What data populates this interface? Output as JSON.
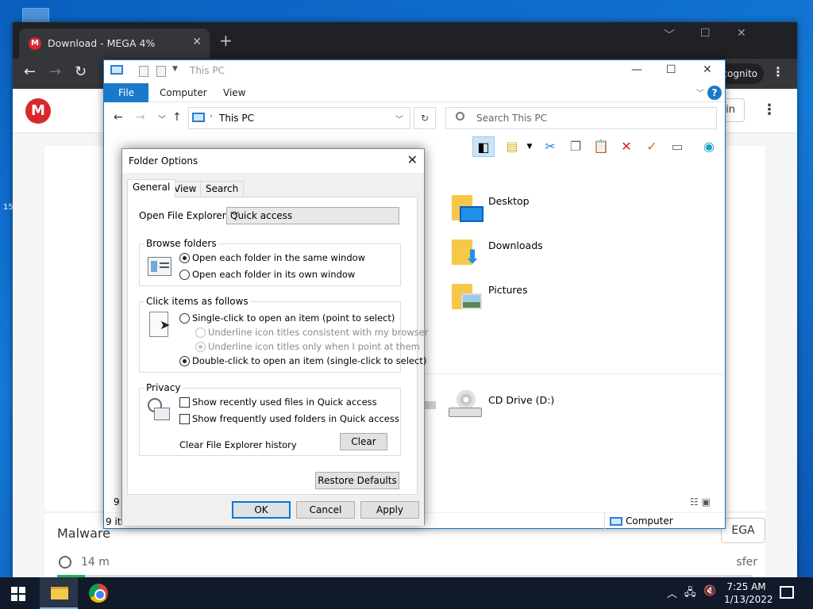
{
  "chrome": {
    "tab_title": "Download - MEGA 4%",
    "tab_close": "✕",
    "new_tab": "+",
    "incognito_label": "cognito",
    "back": "←",
    "forward": "→",
    "reload": "↻"
  },
  "mega": {
    "logo": "M",
    "sign_in_fragment": "in",
    "title_fragment": "Malware",
    "right_button_fragment": "EGA",
    "speed_fragment": "14 m",
    "transfer_fragment": "sfer",
    "progress_percent": 4,
    "brand_color": "#d9272e",
    "progress_color": "#20b45a"
  },
  "explorer": {
    "title": "This PC",
    "ribbon_tabs": [
      "File",
      "Computer",
      "View"
    ],
    "address": "This PC",
    "search_placeholder": "Search This PC",
    "folders": [
      "Desktop",
      "Downloads",
      "Pictures"
    ],
    "drive": "CD Drive (D:)",
    "status_items": "9 ite",
    "status_fragment": "9",
    "status_location": "Computer",
    "accent_color": "#1979ca"
  },
  "folder_options": {
    "title": "Folder Options",
    "tabs": [
      "General",
      "View",
      "Search"
    ],
    "open_to_label": "Open File Explorer to:",
    "open_to_value": "Quick access",
    "browse": {
      "title": "Browse folders",
      "same_window": "Open each folder in the same window",
      "own_window": "Open each folder in its own window"
    },
    "click": {
      "title": "Click items as follows",
      "single": "Single-click to open an item (point to select)",
      "underline_consistent": "Underline icon titles consistent with my browser",
      "underline_point": "Underline icon titles only when I point at them",
      "double": "Double-click to open an item (single-click to select)"
    },
    "privacy": {
      "title": "Privacy",
      "recent_files": "Show recently used files in Quick access",
      "frequent_folders": "Show frequently used folders in Quick access",
      "clear_label": "Clear File Explorer history",
      "clear_button": "Clear"
    },
    "restore_defaults": "Restore Defaults",
    "ok": "OK",
    "cancel": "Cancel",
    "apply": "Apply"
  },
  "taskbar": {
    "time": "7:25 AM",
    "date": "1/13/2022"
  }
}
